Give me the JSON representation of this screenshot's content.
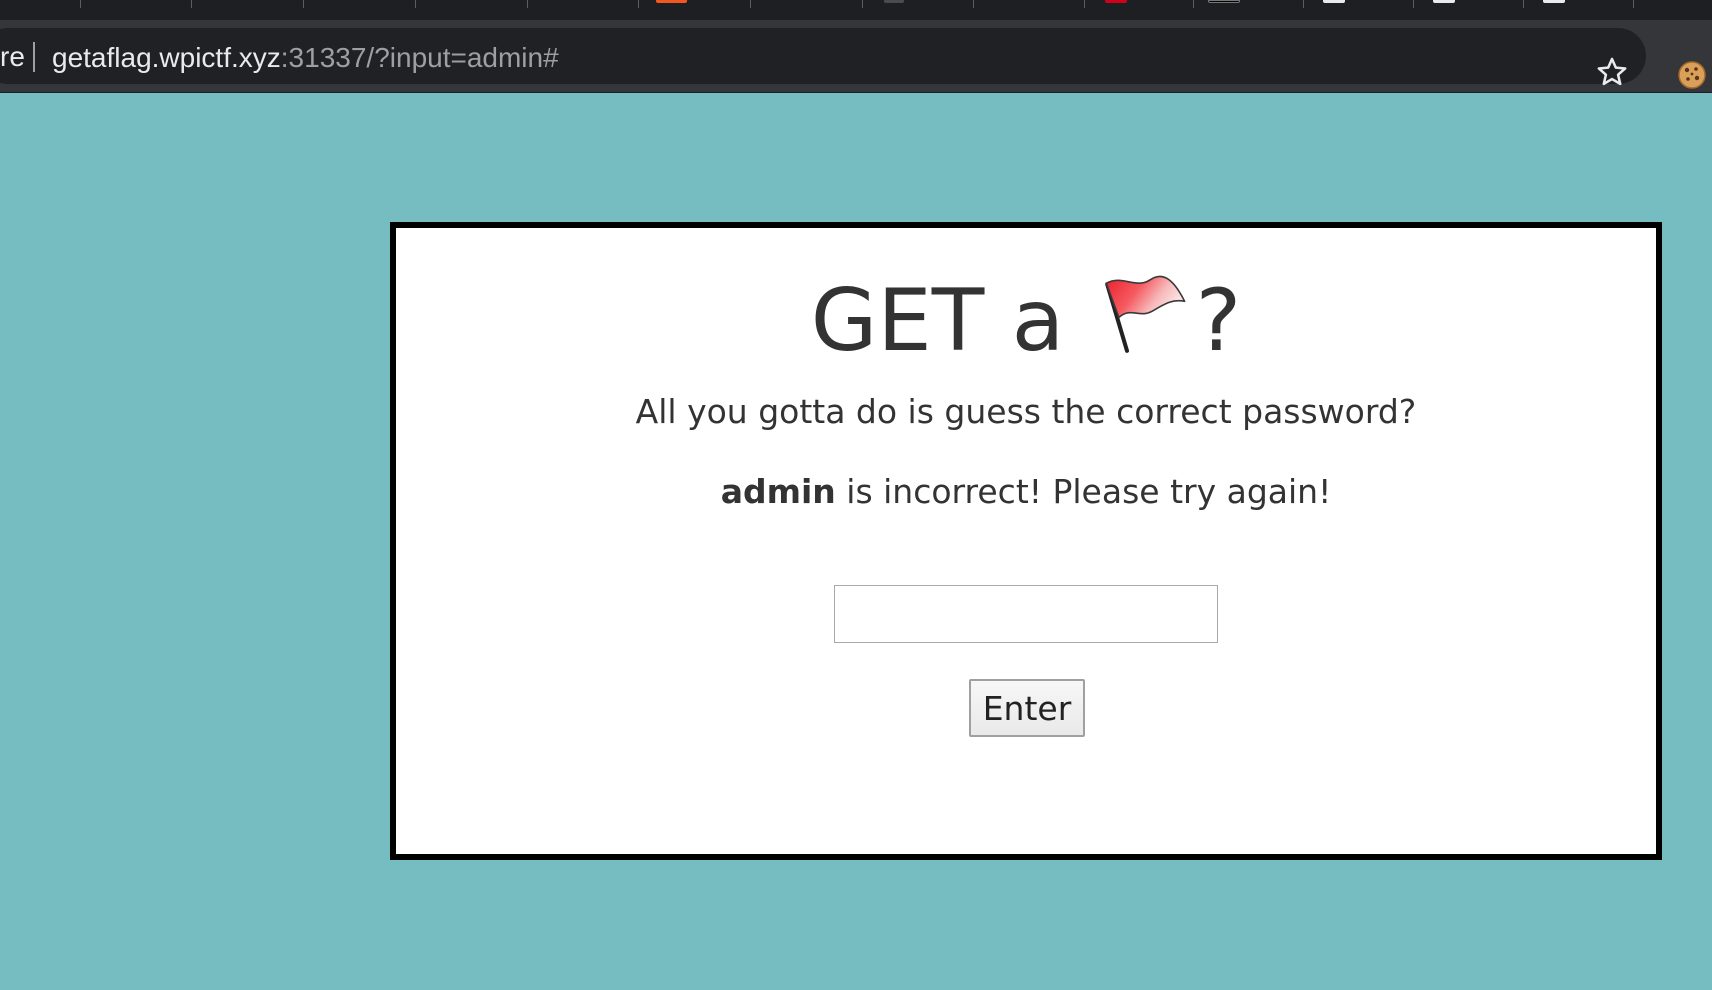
{
  "browser": {
    "url_prefix": "re",
    "url_host": "getaflag.wpictf.xyz",
    "url_rest": ":31337/?input=admin#"
  },
  "page": {
    "title_text": "GET a",
    "title_suffix": "?",
    "subtitle": "All you gotta do is guess the correct password?",
    "message_value": "admin",
    "message_text": " is incorrect! Please try again!",
    "password_value": "",
    "button_label": "Enter"
  },
  "icons": {
    "title_icon": "red-flag-icon",
    "bookmark": "star-outline-icon",
    "extension": "cookie-icon"
  },
  "colors": {
    "page_background": "#75bdc1",
    "card_background": "#ffffff",
    "card_border": "#000000",
    "text": "#333333",
    "toolbar": "#35363a",
    "omnibox": "#202124"
  }
}
